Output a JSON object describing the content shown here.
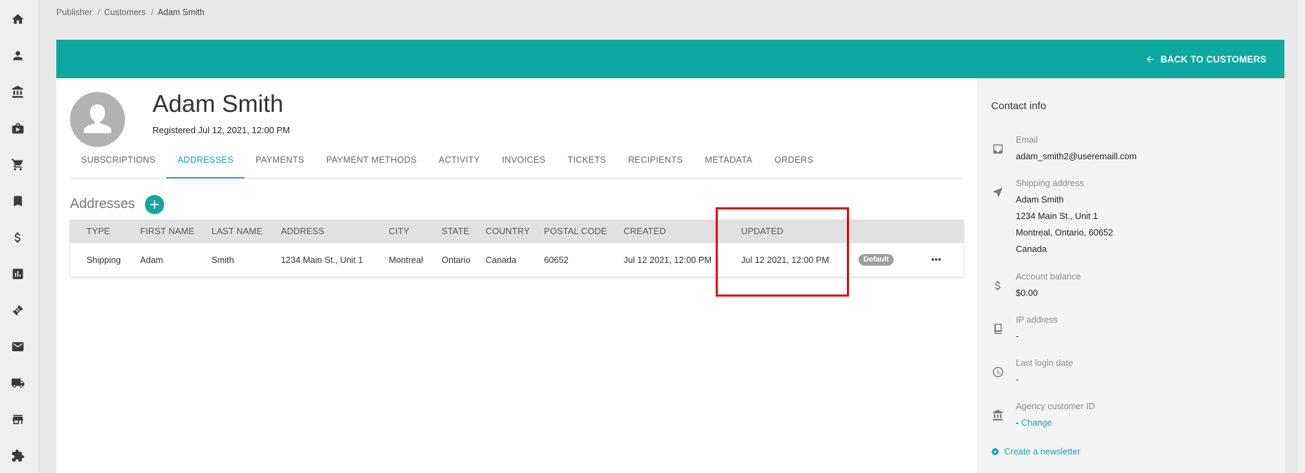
{
  "breadcrumb": {
    "items": [
      "Publisher",
      "Customers",
      "Adam Smith"
    ],
    "separator": "/"
  },
  "header": {
    "back_label": "BACK TO CUSTOMERS"
  },
  "profile": {
    "name": "Adam Smith",
    "registered": "Registered Jul 12, 2021, 12:00 PM"
  },
  "tabs": [
    "SUBSCRIPTIONS",
    "ADDRESSES",
    "PAYMENTS",
    "PAYMENT METHODS",
    "ACTIVITY",
    "INVOICES",
    "TICKETS",
    "RECIPIENTS",
    "METADATA",
    "ORDERS"
  ],
  "active_tab": "ADDRESSES",
  "addresses": {
    "title": "Addresses",
    "columns": [
      "TYPE",
      "FIRST NAME",
      "LAST NAME",
      "ADDRESS",
      "CITY",
      "STATE",
      "COUNTRY",
      "POSTAL CODE",
      "CREATED",
      "UPDATED"
    ],
    "rows": [
      {
        "type": "Shipping",
        "first_name": "Adam",
        "last_name": "Smith",
        "address": "1234 Main St., Unit 1",
        "city": "Montreal",
        "state": "Ontario",
        "country": "Canada",
        "postal_code": "60652",
        "created": "Jul 12 2021, 12:00 PM",
        "updated": "Jul 12 2021, 12:00 PM",
        "badge": "Default"
      }
    ]
  },
  "contact": {
    "title": "Contact info",
    "email_label": "Email",
    "email_value": "adam_smith2@useremaill.com",
    "shipping_label": "Shipping address",
    "shipping_line1": "Adam Smith",
    "shipping_line2": "1234 Main St., Unit 1",
    "shipping_line3": "Montreal, Ontario, 60652",
    "shipping_line4": "Canada",
    "balance_label": "Account balance",
    "balance_value": "$0.00",
    "ip_label": "IP address",
    "ip_value": "-",
    "login_label": "Last login date",
    "login_value": "-",
    "agency_label": "Agency customer ID",
    "agency_value": "-",
    "agency_link": "Change",
    "newsletter_label": "Create a newsletter"
  },
  "colors": {
    "accent": "#0da8a0",
    "highlight": "#e30000",
    "badge": "#9e9e9e"
  },
  "icons": {
    "rail": [
      "home-icon",
      "person-icon",
      "bank-icon",
      "briefcase-icon",
      "cart-icon",
      "bookmark-icon",
      "dollar-icon",
      "chart-icon",
      "ticket-icon",
      "mail-icon",
      "truck-icon",
      "store-icon",
      "puzzle-icon"
    ],
    "contact": [
      "email-icon",
      "navigation-icon",
      "dollar-icon",
      "book-icon",
      "clock-icon",
      "bank-icon"
    ]
  }
}
